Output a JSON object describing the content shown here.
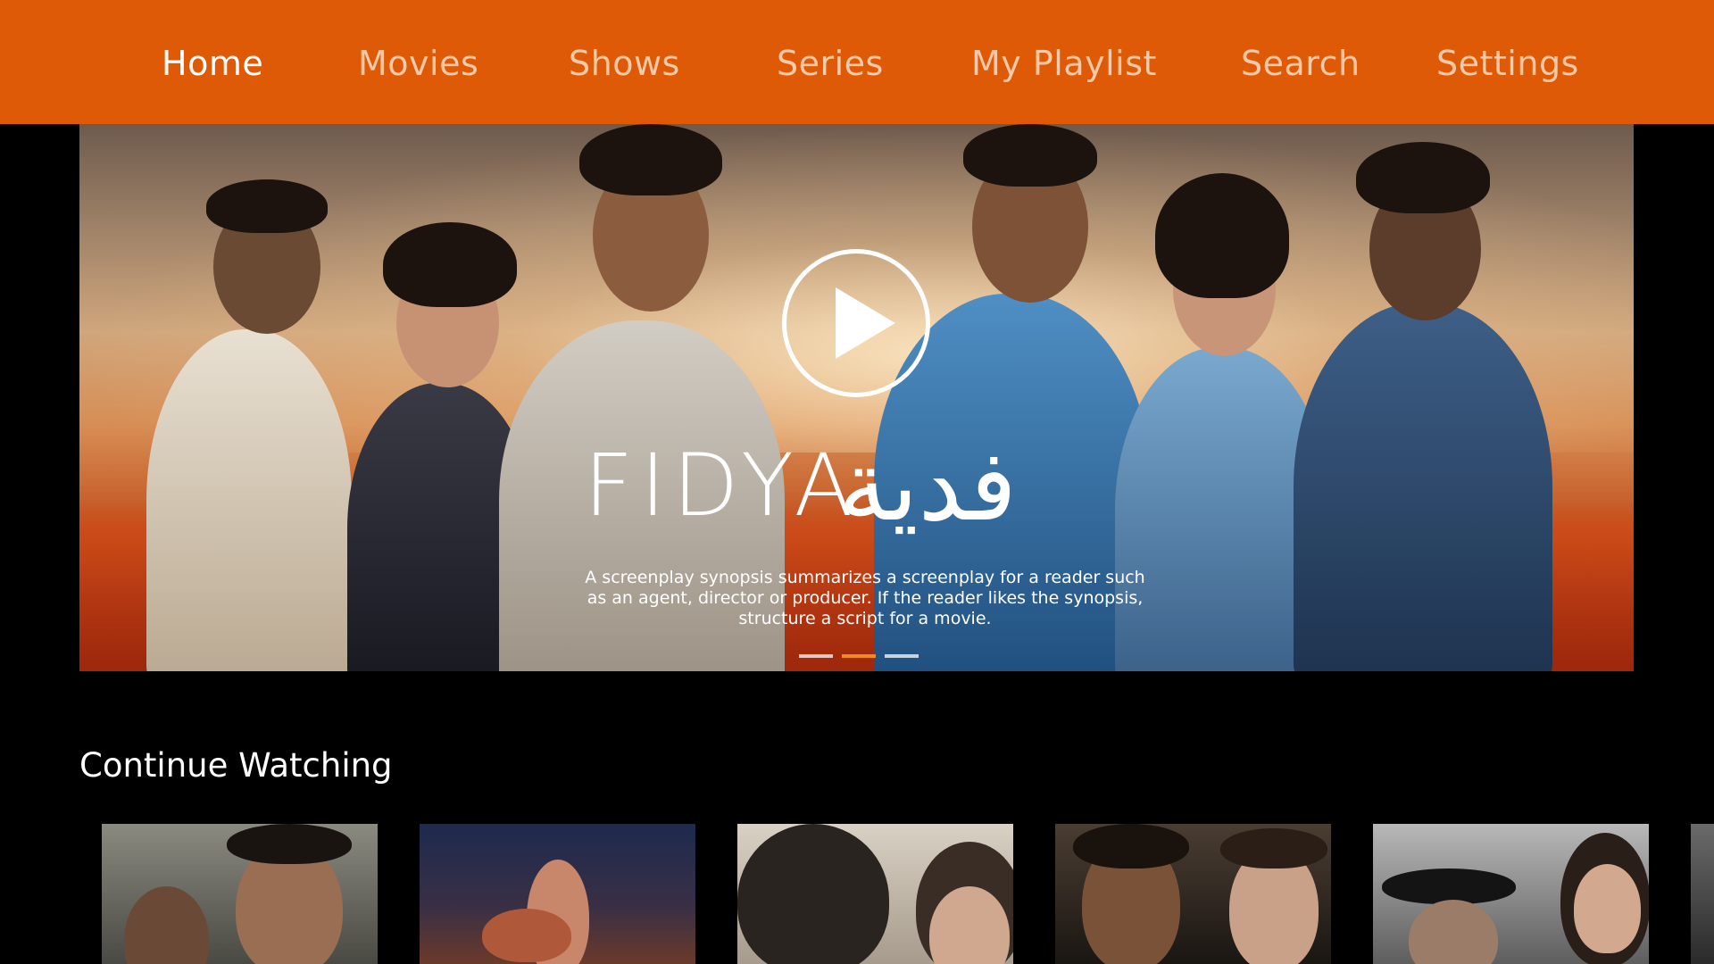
{
  "nav": {
    "items": [
      {
        "label": "Home",
        "active": true
      },
      {
        "label": "Movies",
        "active": false
      },
      {
        "label": "Shows",
        "active": false
      },
      {
        "label": "Series",
        "active": false
      },
      {
        "label": "My Playlist",
        "active": false
      },
      {
        "label": "Search",
        "active": false
      },
      {
        "label": "Settings",
        "active": false
      }
    ]
  },
  "hero": {
    "title": "FIDYA",
    "title_arabic": "فدية",
    "synopsis": "A screenplay synopsis summarizes a screenplay for a reader such as an agent, director or producer. If the reader likes the synopsis, structure a script for a movie.",
    "play_icon": "play-circle-icon",
    "carousel": {
      "count": 3,
      "active_index": 1
    }
  },
  "continue_watching": {
    "title": "Continue Watching",
    "items": [
      {
        "thumbnail": "movie-poster-1"
      },
      {
        "thumbnail": "movie-poster-2"
      },
      {
        "thumbnail": "movie-poster-3"
      },
      {
        "thumbnail": "movie-poster-4"
      },
      {
        "thumbnail": "movie-poster-5"
      },
      {
        "thumbnail": "movie-poster-6"
      }
    ]
  },
  "colors": {
    "nav_bg": "#de5a06",
    "nav_text": "#f6c9a8",
    "nav_active_text": "#ffffff",
    "accent": "#f08a22",
    "background": "#000000"
  }
}
